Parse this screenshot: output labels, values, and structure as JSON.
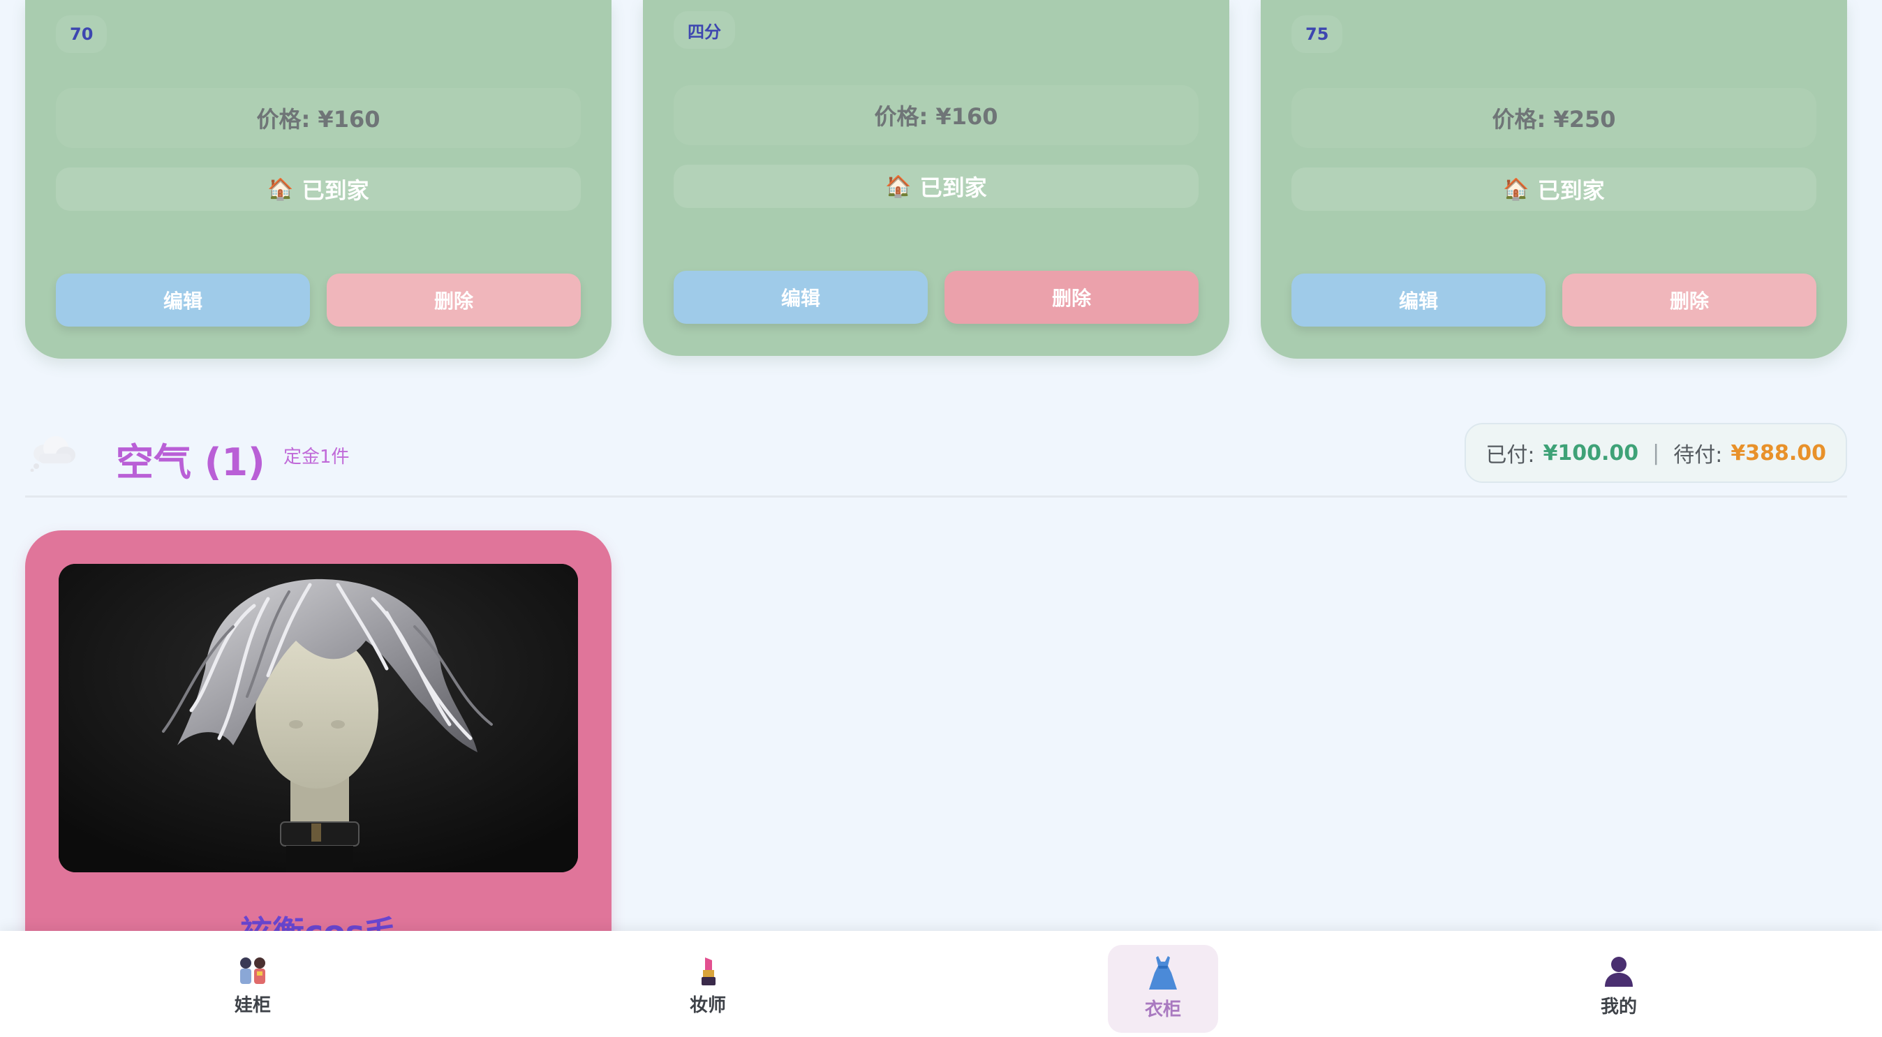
{
  "cards": [
    {
      "tag": "70",
      "price": "价格: ¥160",
      "status": "已到家",
      "edit": "编辑",
      "delete": "删除"
    },
    {
      "tag": "四分",
      "price": "价格: ¥160",
      "status": "已到家",
      "edit": "编辑",
      "delete": "删除"
    },
    {
      "tag": "75",
      "price": "价格: ¥250",
      "status": "已到家",
      "edit": "编辑",
      "delete": "删除"
    }
  ],
  "section": {
    "icon": "cloud-icon",
    "title": "空气 (1)",
    "subtitle": "定金1件",
    "paid_label": "已付:",
    "paid_value": "¥100.00",
    "separator": "|",
    "due_label": "待付:",
    "due_value": "¥388.00"
  },
  "item": {
    "title": "袨衡cos毛"
  },
  "nav": [
    {
      "label": "娃柜",
      "icon": "dolls-icon",
      "active": false
    },
    {
      "label": "妆师",
      "icon": "lipstick-icon",
      "active": false
    },
    {
      "label": "衣柜",
      "icon": "dress-icon",
      "active": true
    },
    {
      "label": "我的",
      "icon": "user-icon",
      "active": false
    }
  ],
  "colors": {
    "card_green": "#a9ccaf",
    "edit_blue": "#9fcbe9",
    "delete_pink": "#f0b6bb",
    "title_purple": "#b95fd6",
    "paid_green": "#3ea277",
    "due_orange": "#e8912a",
    "item_card_pink": "#e0759a"
  }
}
